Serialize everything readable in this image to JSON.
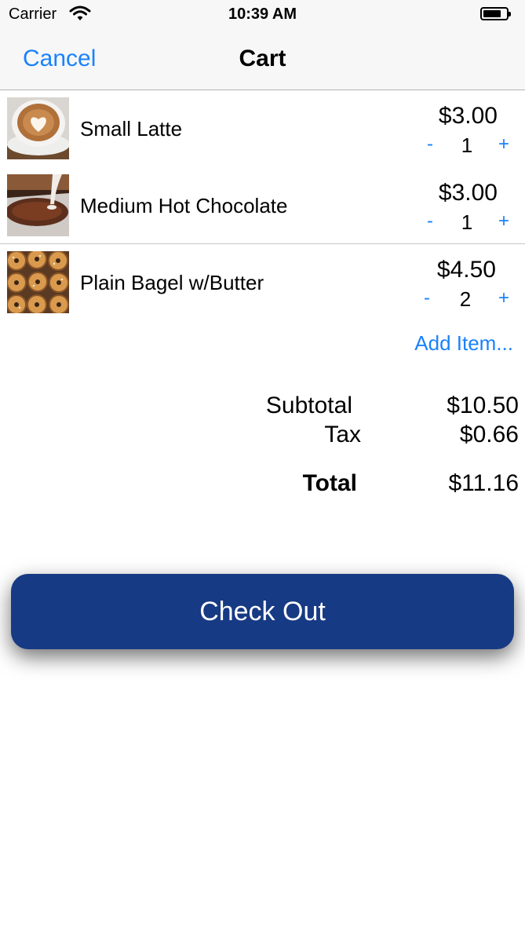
{
  "status_bar": {
    "carrier": "Carrier",
    "time": "10:39 AM"
  },
  "nav": {
    "cancel_label": "Cancel",
    "title": "Cart"
  },
  "cart": {
    "items": [
      {
        "name": "Small Latte",
        "price": "$3.00",
        "quantity": "1",
        "minus_label": "-",
        "plus_label": "+",
        "image": "latte-photo"
      },
      {
        "name": "Medium Hot Chocolate",
        "price": "$3.00",
        "quantity": "1",
        "minus_label": "-",
        "plus_label": "+",
        "image": "hot-chocolate-photo"
      },
      {
        "name": "Plain Bagel w/Butter",
        "price": "$4.50",
        "quantity": "2",
        "minus_label": "-",
        "plus_label": "+",
        "image": "bagels-photo"
      }
    ],
    "add_item_label": "Add Item..."
  },
  "summary": {
    "subtotal_label": "Subtotal",
    "subtotal_value": "$10.50",
    "tax_label": "Tax",
    "tax_value": "$0.66",
    "total_label": "Total",
    "total_value": "$11.16"
  },
  "checkout_label": "Check Out",
  "colors": {
    "accent": "#1a82fb",
    "checkout_button": "#173a84"
  }
}
